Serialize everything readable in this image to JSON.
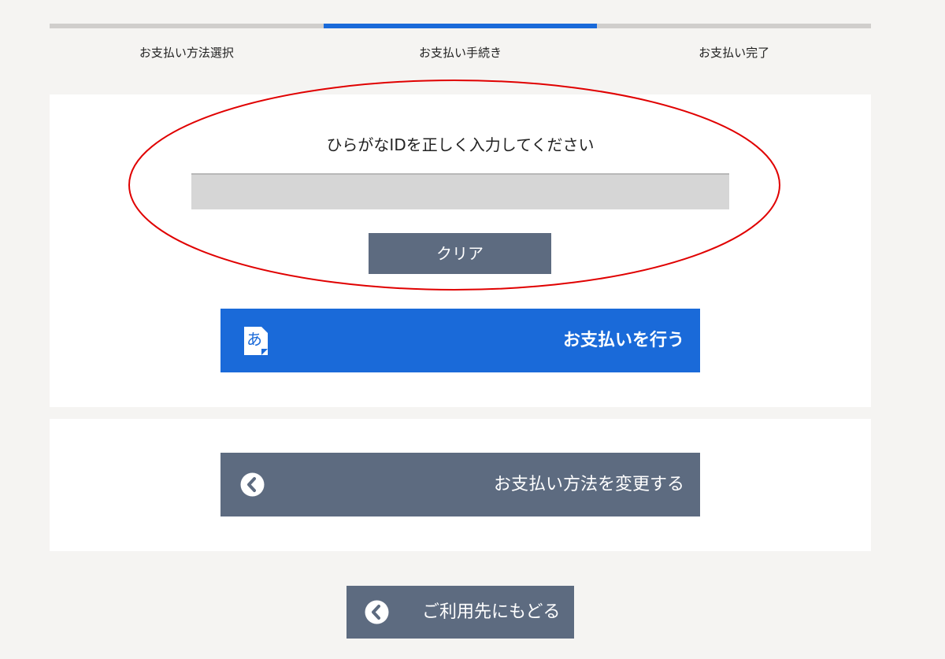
{
  "steps": [
    {
      "label": "お支払い方法選択",
      "active": false
    },
    {
      "label": "お支払い手続き",
      "active": true
    },
    {
      "label": "お支払い完了",
      "active": false
    }
  ],
  "form": {
    "instruction": "ひらがなIDを正しく入力してください",
    "id_value": "",
    "clear_label": "クリア"
  },
  "buttons": {
    "pay_label": "お支払いを行う",
    "change_method_label": "お支払い方法を変更する",
    "back_label": "ご利用先にもどる"
  },
  "icons": {
    "pay": "hiragana-a-icon",
    "change": "chevron-left-circle-icon",
    "back": "chevron-left-circle-icon"
  },
  "colors": {
    "accent_blue": "#1a6ad9",
    "button_slate": "#5d6b80",
    "annotation_red": "#e00000"
  }
}
